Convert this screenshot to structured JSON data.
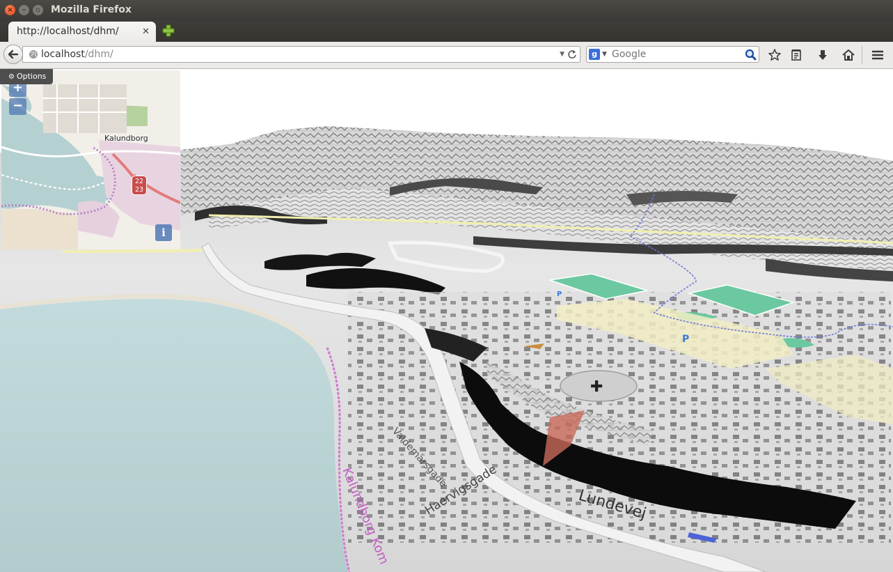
{
  "window": {
    "title": "Mozilla Firefox"
  },
  "tab": {
    "label": "http://localhost/dhm/",
    "close": "✕"
  },
  "navbar": {
    "url_host": "localhost",
    "url_path": "/dhm/",
    "search_placeholder": "Google",
    "search_engine": "g"
  },
  "content": {
    "options_label": "Options",
    "minimap": {
      "zoom_in": "+",
      "zoom_out": "−",
      "info": "i",
      "town_label": "Kalundborg",
      "road_badge_top": "22",
      "road_badge_bottom": "23"
    },
    "street_labels": [
      "Lundevej",
      "Haervigsgade",
      "Valdemarsgade",
      "Kalundborg Kom",
      "P",
      "P"
    ]
  }
}
